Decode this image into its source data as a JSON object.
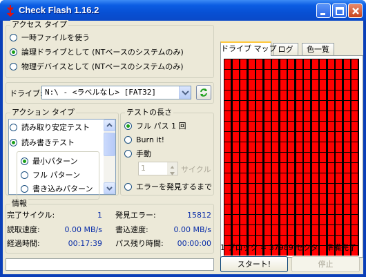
{
  "window": {
    "title": "Check Flash 1.16.2",
    "controls": [
      "minimize",
      "maximize",
      "close"
    ]
  },
  "access_type": {
    "legend": "アクセス タイプ",
    "options": [
      {
        "label": "一時ファイルを使う",
        "selected": false
      },
      {
        "label": "論理ドライブとして (NTベースのシステムのみ)",
        "selected": true
      },
      {
        "label": "物理デバイスとして (NTベースのシステムのみ)",
        "selected": false
      }
    ]
  },
  "drive": {
    "label": "ドライブ:",
    "value": "N:\\ - <ラベルなし> [FAT32]",
    "refresh_icon": "refresh-icon"
  },
  "action_type": {
    "legend": "アクション タイプ",
    "options": [
      {
        "label": "読み取り安定テスト",
        "selected": false
      },
      {
        "label": "読み書きテスト",
        "selected": true
      }
    ],
    "sub_options": [
      {
        "label": "最小パターン",
        "selected": true
      },
      {
        "label": "フル パターン",
        "selected": false
      },
      {
        "label": "書き込みパターン",
        "selected": false
      }
    ]
  },
  "test_length": {
    "legend": "テストの長さ",
    "options": [
      {
        "label": "フル パス 1 回",
        "selected": true
      },
      {
        "label": "Burn it!",
        "selected": false
      },
      {
        "label": "手動",
        "selected": false
      }
    ],
    "cycles_value": "1",
    "cycles_label": "サイクル",
    "until_error_label": "エラーを発見するまで"
  },
  "info": {
    "legend": "情報",
    "completed_cycles_label": "完了サイクル:",
    "completed_cycles_value": "1",
    "errors_found_label": "発見エラー:",
    "errors_found_value": "15812",
    "read_speed_label": "読取速度:",
    "read_speed_value": "0.00 MB/s",
    "write_speed_label": "書込速度:",
    "write_speed_value": "0.00 MB/s",
    "elapsed_label": "経過時間:",
    "elapsed_value": "00:17:39",
    "remaining_label": "パス残り時間:",
    "remaining_value": "00:00:00"
  },
  "tabs": [
    {
      "label": "ドライブ マップ",
      "active": true
    },
    {
      "label": "ログ",
      "active": false
    },
    {
      "label": "色一覧",
      "active": false
    }
  ],
  "drive_map": {
    "rows": 19,
    "cols": 17,
    "block_color": "#ff0000",
    "block_info": "1 ブロック = 37989 セクタ",
    "status": "準備完了"
  },
  "buttons": {
    "start": "スタート!",
    "stop": "停止"
  },
  "colors": {
    "title_bar": "#0750d4",
    "face": "#ece9d8",
    "block_error": "#ff0000",
    "value_text": "#0a2ea8"
  }
}
